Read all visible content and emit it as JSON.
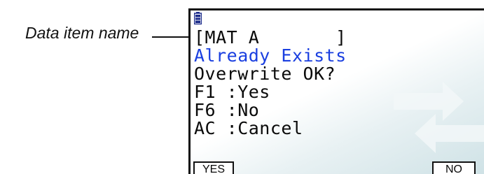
{
  "callout": {
    "label": "Data item name"
  },
  "screen": {
    "status_icon": "battery-icon",
    "lines": [
      "[MAT A       ]",
      "Already Exists",
      "Overwrite OK?",
      "F1 :Yes",
      "F6 :No",
      "AC :Cancel"
    ],
    "accent_color": "#1a3fe0",
    "background_icon": "transfer-arrows-icon"
  },
  "function_keys": {
    "f1_label": "YES",
    "f6_label": "NO"
  }
}
